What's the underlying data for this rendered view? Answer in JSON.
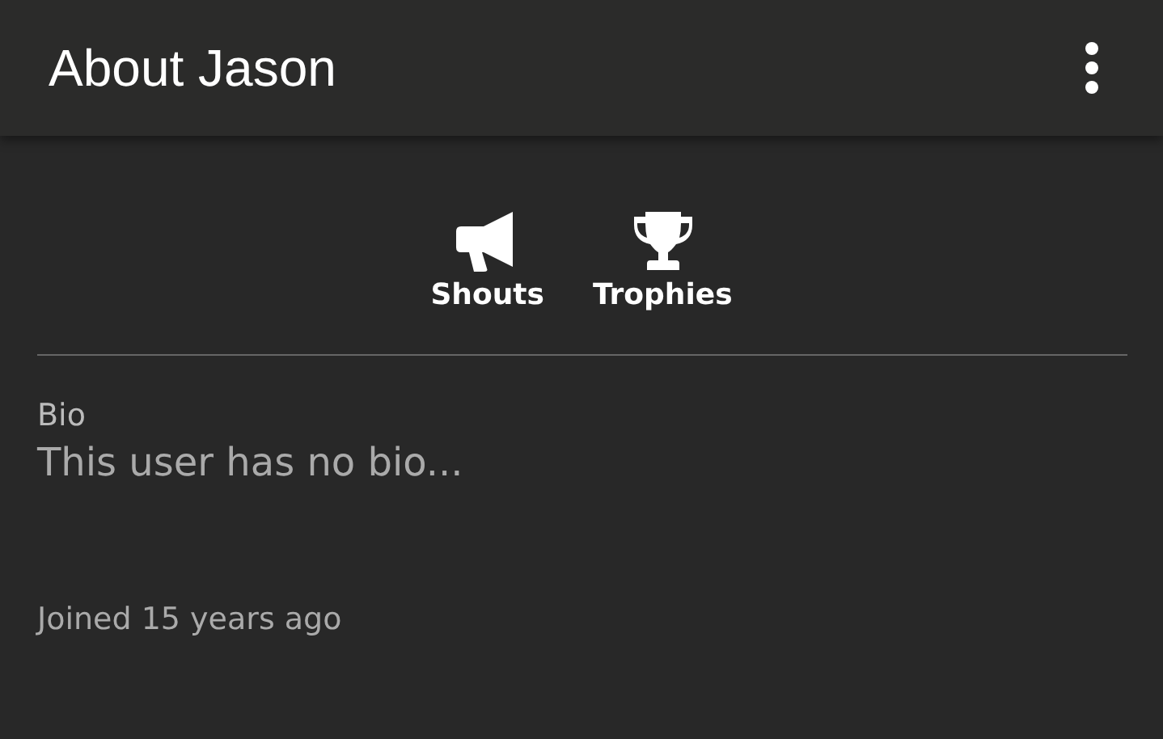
{
  "app_bar": {
    "title": "About Jason"
  },
  "actions": [
    {
      "kind": "megaphone",
      "label": "Shouts"
    },
    {
      "kind": "trophy",
      "label": "Trophies"
    }
  ],
  "bio": {
    "label": "Bio",
    "text": "This user has no bio..."
  },
  "joined": "Joined 15 years ago"
}
